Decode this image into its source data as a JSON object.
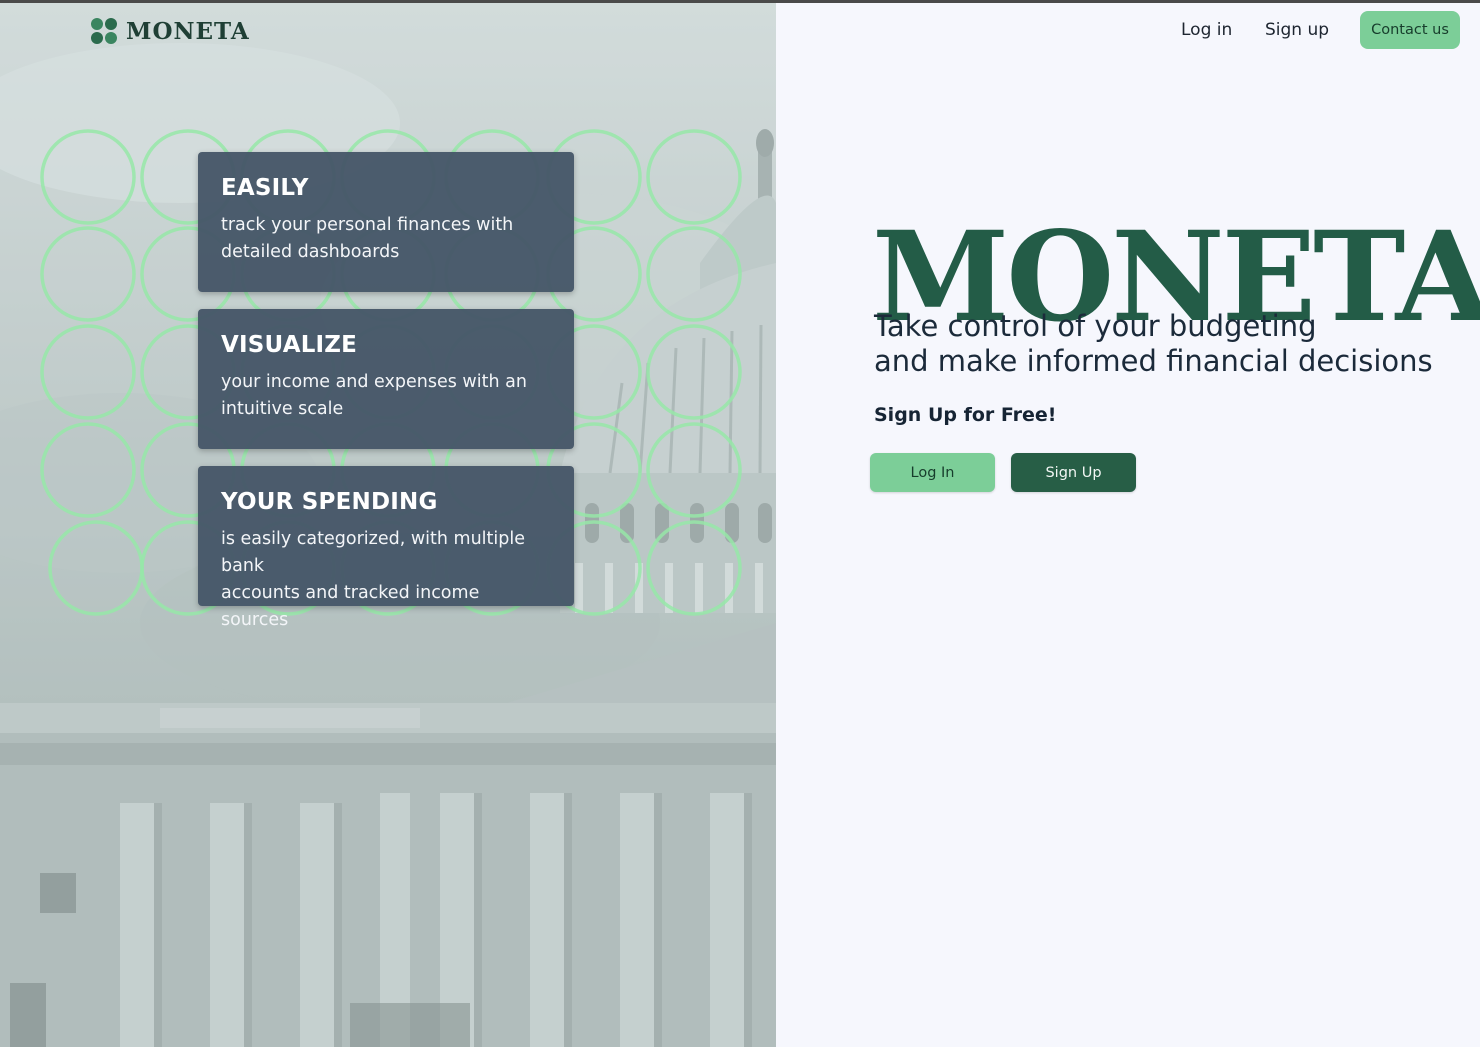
{
  "brand": {
    "name": "MONETA",
    "logo_icon": "four-dot-clover-icon"
  },
  "nav": {
    "login_label": "Log in",
    "signup_label": "Sign up",
    "contact_label": "Contact us"
  },
  "features": [
    {
      "title": "EASILY",
      "text_line1": "track your personal finances with",
      "text_line2": "detailed dashboards"
    },
    {
      "title": "VISUALIZE",
      "text_line1": "your income and expenses with an",
      "text_line2": "intuitive scale"
    },
    {
      "title": "YOUR SPENDING",
      "text_line1": "is easily categorized, with multiple bank",
      "text_line2": "accounts and tracked income sources"
    }
  ],
  "hero": {
    "title": "MONETA",
    "tagline_line1": "Take control of your budgeting",
    "tagline_line2": "and make informed financial decisions",
    "cta_heading": "Sign Up for Free!",
    "login_button": "Log In",
    "signup_button": "Sign Up"
  },
  "colors": {
    "brand_dark_green": "#235c47",
    "accent_mint": "#7cce98",
    "card_slate": "#465668",
    "circle_outline": "#96e8a8",
    "background": "#f6f7fd"
  }
}
